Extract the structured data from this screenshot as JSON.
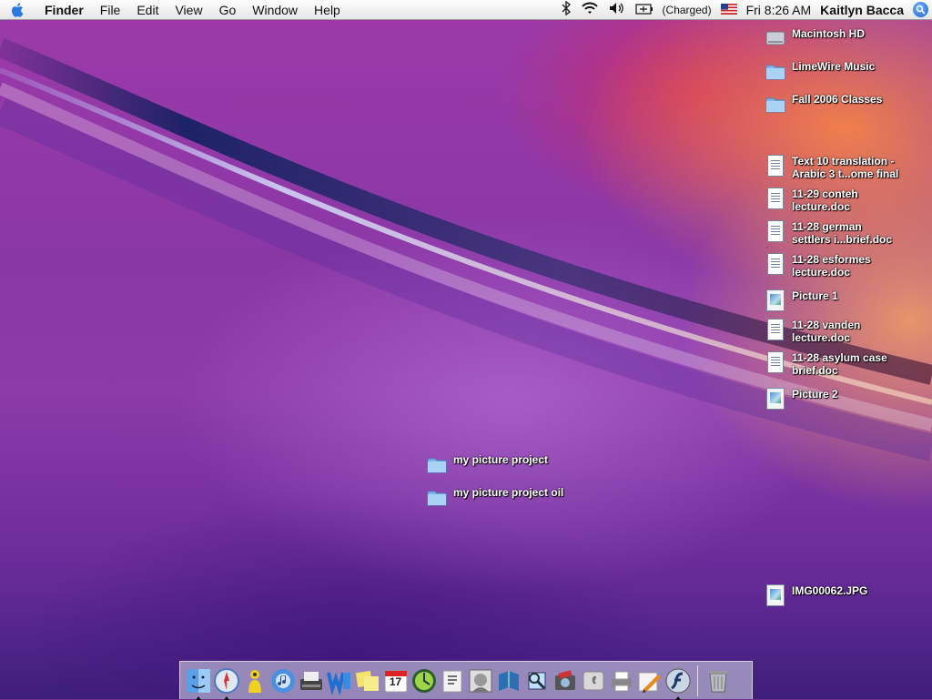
{
  "menubar": {
    "app_menu": "Finder",
    "items": [
      "File",
      "Edit",
      "View",
      "Go",
      "Window",
      "Help"
    ],
    "battery_status": "(Charged)",
    "clock": "Fri 8:26 AM",
    "user": "Kaitlyn Bacca"
  },
  "desktop_icons": {
    "hd": "Macintosh HD",
    "limewire": "LimeWire Music",
    "fall2006": "Fall 2006 Classes",
    "text10": "Text 10 translation -\nArabic 3 t...ome final",
    "conteh": "11-29 conteh\nlecture.doc",
    "german": "11-28 german\nsettlers i...brief.doc",
    "esformes": "11-28 esformes\nlecture.doc",
    "picture1": "Picture 1",
    "vanden": "11-28 vanden\nlecture.doc",
    "asylum": "11-28 asylum case\nbrief.doc",
    "picture2": "Picture 2",
    "project": "my picture project",
    "project_oil": "my picture project oil",
    "img": "IMG00062.JPG"
  },
  "dock": {
    "calendar_day": "17",
    "items": [
      "finder",
      "safari",
      "aim",
      "itunes",
      "typewriter",
      "word",
      "stickies",
      "ical",
      "widget",
      "dictionary",
      "einstein",
      "book",
      "preview",
      "iphoto",
      "apple",
      "printer",
      "pencil",
      "flash",
      "trash"
    ]
  },
  "colors": {
    "menubar_bg": "#f0f0f0",
    "label_text": "#ffffff",
    "spotlight": "#1f5fc8"
  }
}
